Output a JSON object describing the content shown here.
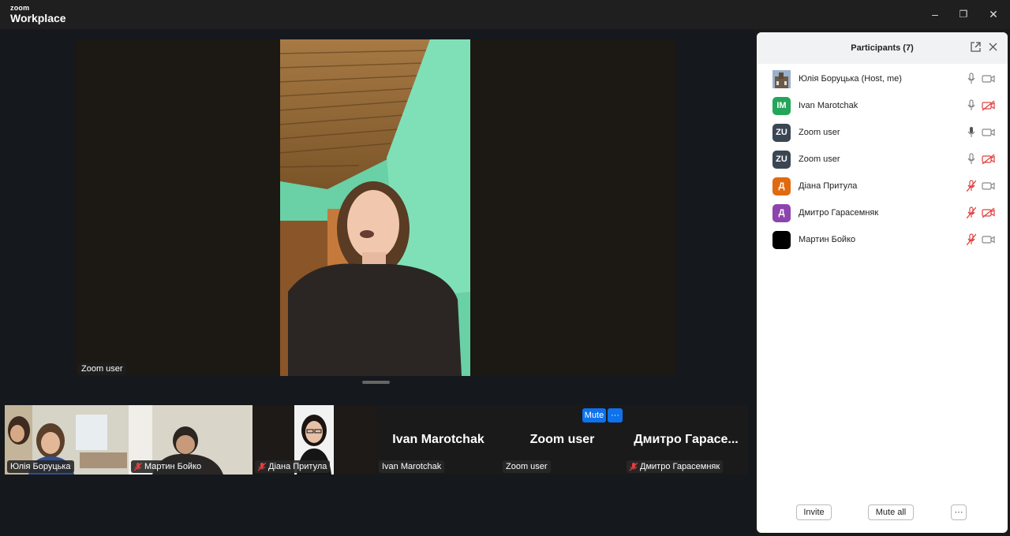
{
  "app": {
    "logo_line1": "zoom",
    "logo_line2": "Workplace"
  },
  "window_controls": {
    "minimize": "–",
    "restore": "❐",
    "close": "✕"
  },
  "main_video": {
    "name": "Zoom user"
  },
  "thumbnails": [
    {
      "name": "Юлія Боруцька",
      "muted": false,
      "display_name": ""
    },
    {
      "name": "Мартин Бойко",
      "muted": true,
      "display_name": ""
    },
    {
      "name": "Діана Притула",
      "muted": true,
      "display_name": ""
    },
    {
      "name": "Ivan Marotchak",
      "muted": false,
      "display_name": "Ivan Marotchak"
    },
    {
      "name": "Zoom user",
      "muted": false,
      "display_name": "Zoom user"
    },
    {
      "name": "Дмитро Гарасемняк",
      "muted": true,
      "display_name": "Дмитро Гарасе..."
    }
  ],
  "hover_controls": {
    "mute_label": "Mute",
    "more_label": "···"
  },
  "participants_panel": {
    "title": "Participants (7)",
    "popout_icon": "popout-icon",
    "close_icon": "close-icon",
    "participants": [
      {
        "name": "Юлія Боруцька (Host, me)",
        "avatar": "",
        "avatar_color": "#7a8aa0",
        "mic": "on",
        "cam": "on"
      },
      {
        "name": "Ivan Marotchak",
        "avatar": "IM",
        "avatar_color": "#23a55a",
        "mic": "on",
        "cam": "off"
      },
      {
        "name": "Zoom user",
        "avatar": "ZU",
        "avatar_color": "#3b4653",
        "mic": "active",
        "cam": "on"
      },
      {
        "name": "Zoom user",
        "avatar": "ZU",
        "avatar_color": "#3b4653",
        "mic": "on",
        "cam": "off"
      },
      {
        "name": "Діана Притула",
        "avatar": "Д",
        "avatar_color": "#e06a10",
        "mic": "muted",
        "cam": "on"
      },
      {
        "name": "Дмитро Гарасемняк",
        "avatar": "Д",
        "avatar_color": "#8e44ad",
        "mic": "muted",
        "cam": "off"
      },
      {
        "name": "Мартин Бойко",
        "avatar": "",
        "avatar_color": "#000000",
        "mic": "muted",
        "cam": "on"
      }
    ],
    "footer": {
      "invite": "Invite",
      "mute_all": "Mute all",
      "more": "···"
    }
  }
}
